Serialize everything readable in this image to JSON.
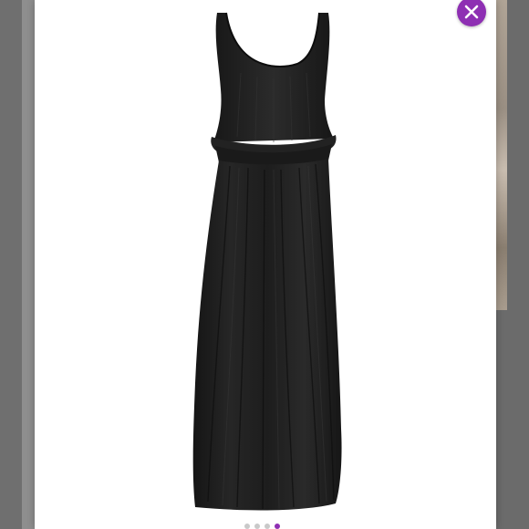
{
  "viewer": {
    "image_icon": "dress-product-photo",
    "close_icon": "close-icon",
    "accent_color": "#8e2fb3",
    "dress_color": "#1c1c1c",
    "carousel": {
      "total": 4,
      "active": 4
    }
  }
}
